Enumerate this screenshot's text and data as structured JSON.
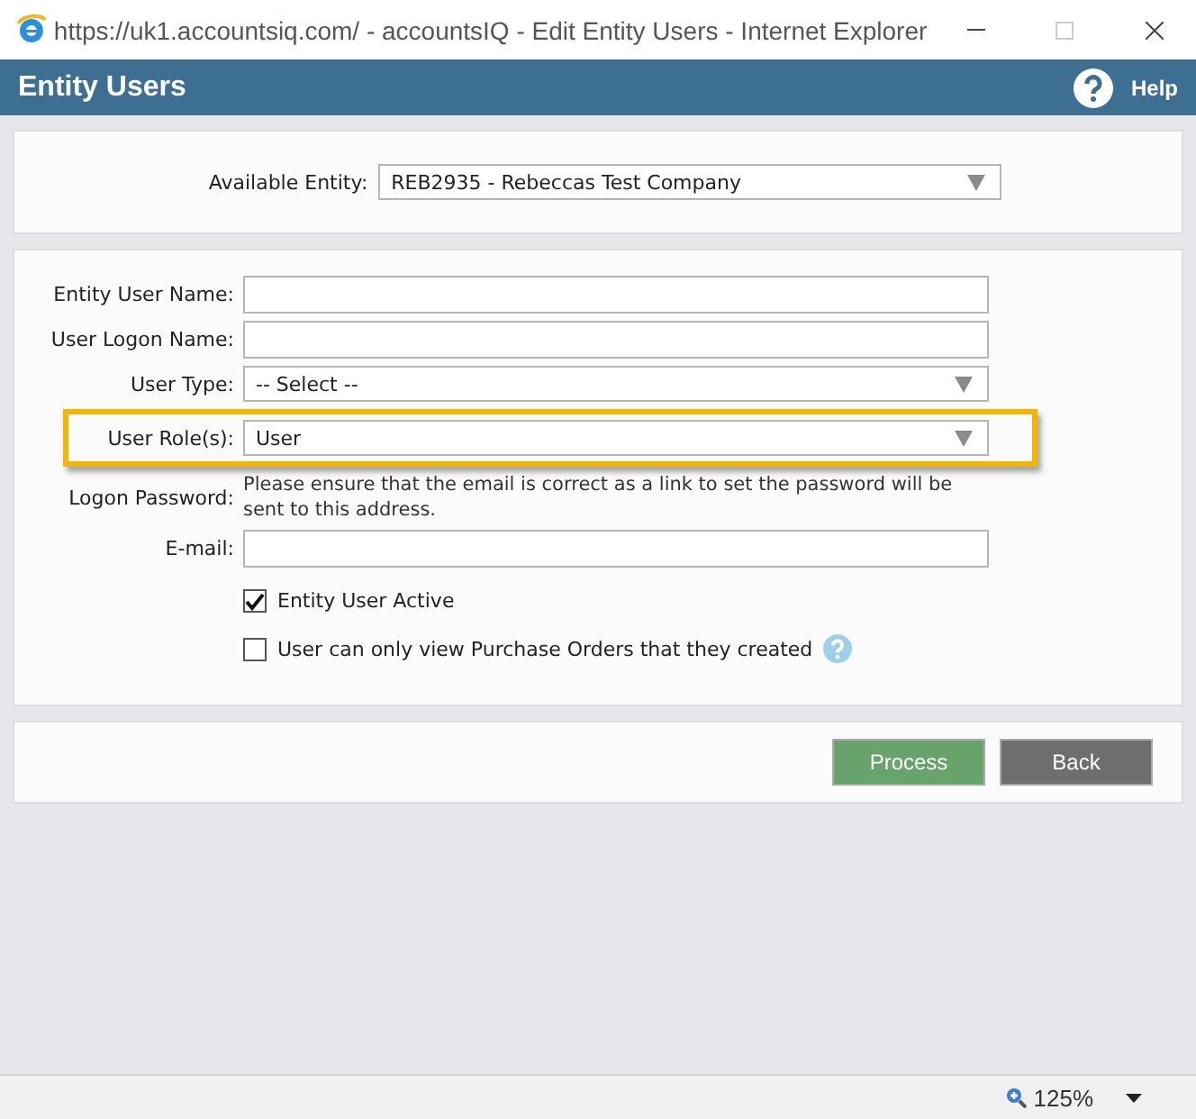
{
  "window": {
    "title": "https://uk1.accountsiq.com/ - accountsIQ - Edit Entity Users - Internet Explorer"
  },
  "header": {
    "title": "Entity Users",
    "help": "Help"
  },
  "entity": {
    "label": "Available Entity:",
    "value": "REB2935 - Rebeccas Test Company"
  },
  "fields": [
    {
      "kind": "text",
      "label": "Entity User Name:",
      "highlighted": false
    },
    {
      "kind": "text",
      "label": "User Logon Name:",
      "highlighted": false
    },
    {
      "kind": "select",
      "label": "User Type:",
      "value": "-- Select --",
      "highlighted": false
    },
    {
      "kind": "select",
      "label": "User Role(s):",
      "value": "User",
      "highlighted": true
    },
    {
      "kind": "note",
      "label": "Logon Password:",
      "text": "Please ensure that the email is correct as a link to set the password will be sent to this address.",
      "highlighted": false
    },
    {
      "kind": "text",
      "label": "E-mail:",
      "highlighted": false
    }
  ],
  "checkboxes": [
    {
      "label": "Entity User Active",
      "checked": true,
      "info": false
    },
    {
      "label": "User can only view Purchase Orders that they created",
      "checked": false,
      "info": true
    }
  ],
  "buttons": [
    {
      "label": "Process",
      "kind": "primary"
    },
    {
      "label": "Back",
      "kind": "secondary"
    }
  ],
  "status_bar": {
    "zoom": "125%"
  }
}
